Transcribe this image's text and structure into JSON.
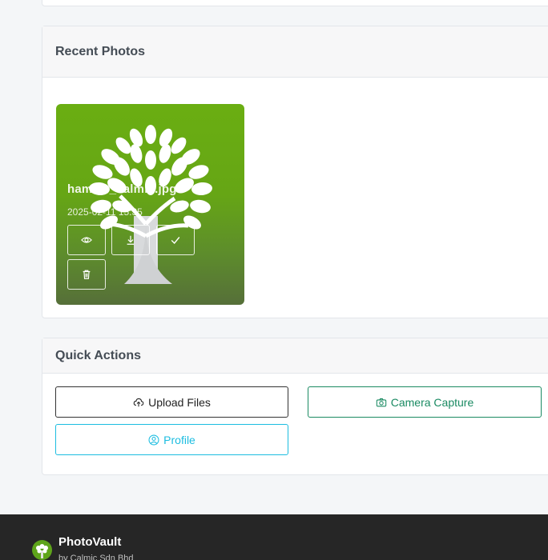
{
  "photos_section": {
    "title": "Recent Photos",
    "items": [
      {
        "filename": "hamwo_calmic.jpg",
        "date": "2025-02-11 15:35"
      }
    ]
  },
  "quick_actions": {
    "title": "Quick Actions",
    "upload_label": "Upload Files",
    "camera_label": "Camera Capture",
    "profile_label": "Profile"
  },
  "footer": {
    "brand": "PhotoVault",
    "sub": "by Calmic Sdn Bhd"
  },
  "colors": {
    "camera_accent": "#1a8a62",
    "profile_accent": "#1cbde0",
    "footer_bg": "#262626"
  }
}
